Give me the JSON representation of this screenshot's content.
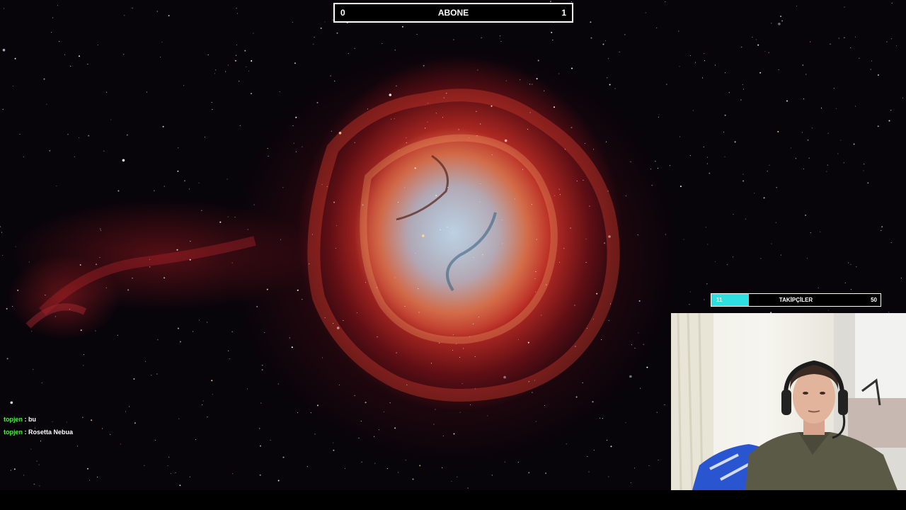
{
  "subscriber_goal": {
    "label": "ABONE",
    "current": "0",
    "target": "1"
  },
  "follower_goal": {
    "label": "TAKİPÇİLER",
    "current": "11",
    "target": "50",
    "progress_fraction": 0.22,
    "fill_color": "#2fe0e3"
  },
  "chat": {
    "messages": [
      {
        "user": "topjen",
        "separator": ":",
        "text": "bu"
      },
      {
        "user": "topjen",
        "separator": ":",
        "text": "Rosetta Nebua"
      }
    ],
    "user_color": "#4fea3f"
  },
  "scene": {
    "background": "rose-nebula-image",
    "webcam": "streamer-webcam-feed"
  }
}
